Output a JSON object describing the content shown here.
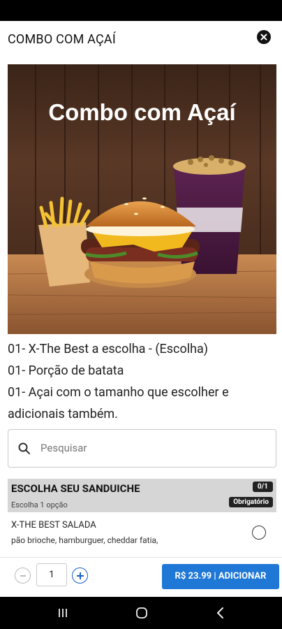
{
  "header": {
    "title": "COMBO COM AÇAÍ",
    "close_icon": "close-circle-icon"
  },
  "hero": {
    "title": "Combo com Açaí",
    "image": "burger-fries-acai-photo"
  },
  "description": {
    "lines": [
      "01- X-The Best a escolha - (Escolha)",
      "01- Porção de batata",
      "01- Açai com o tamanho que escolher e adicionais também."
    ]
  },
  "search": {
    "placeholder": "Pesquisar",
    "icon": "search-icon"
  },
  "section": {
    "title": "ESCOLHA SEU SANDUICHE",
    "subtitle": "Escolha 1 opção",
    "count": "0/1",
    "required": "Obrigatório"
  },
  "option": {
    "name": "X-THE BEST SALADA",
    "description": "pão brioche, hamburguer, cheddar fatia,",
    "selected": false
  },
  "cart": {
    "quantity": "1",
    "add_label": "R$ 23.99 | ADICIONAR"
  },
  "colors": {
    "accent": "#1f78d6",
    "section_bg": "#d6d6d6"
  },
  "nav": {
    "icons": [
      "recents-icon",
      "home-icon",
      "back-icon"
    ]
  }
}
